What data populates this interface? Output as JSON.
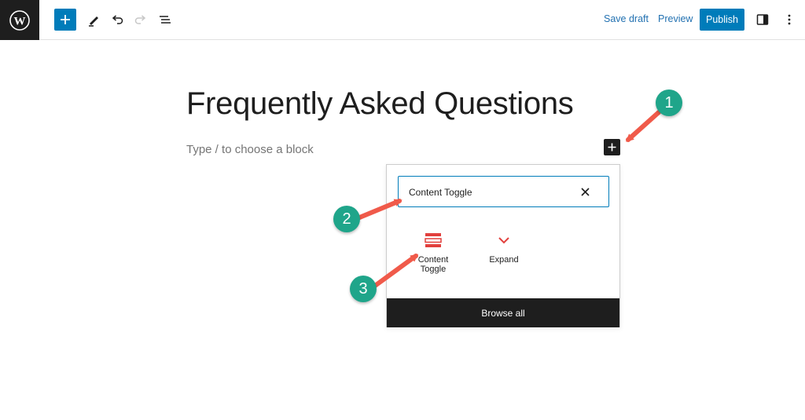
{
  "toolbar": {
    "save_draft_label": "Save draft",
    "preview_label": "Preview",
    "publish_label": "Publish"
  },
  "editor": {
    "title": "Frequently Asked Questions",
    "block_placeholder": "Type / to choose a block"
  },
  "inserter": {
    "search_value": "Content Toggle",
    "results": [
      {
        "label": "Content Toggle",
        "icon": "content-toggle-icon"
      },
      {
        "label": "Expand",
        "icon": "chevron-down-icon"
      }
    ],
    "browse_all_label": "Browse all"
  },
  "callouts": [
    "1",
    "2",
    "3"
  ],
  "colors": {
    "accent": "#007cba",
    "callout": "#1fa58a",
    "arrow": "#f05a4a",
    "block_icon": "#e2403d"
  }
}
